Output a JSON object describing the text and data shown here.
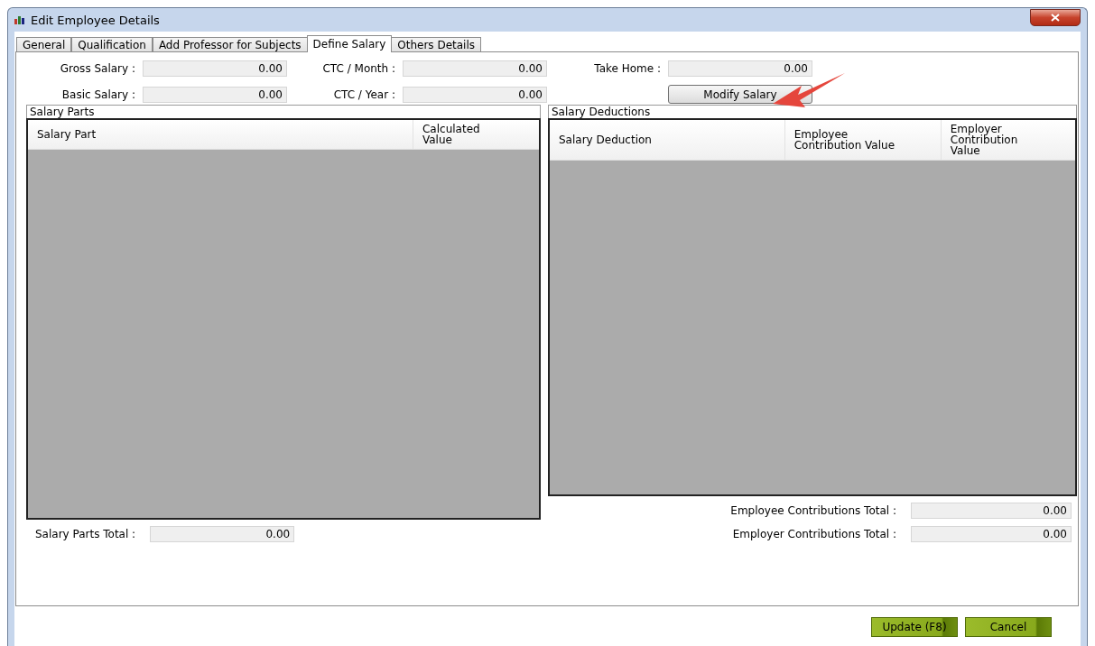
{
  "window": {
    "title": "Edit Employee Details"
  },
  "tabs": [
    {
      "label": "General",
      "selected": false
    },
    {
      "label": "Qualification",
      "selected": false
    },
    {
      "label": "Add Professor for Subjects",
      "selected": false
    },
    {
      "label": "Define Salary",
      "selected": true
    },
    {
      "label": "Others Details",
      "selected": false
    }
  ],
  "salary_fields": [
    {
      "label": "Gross Salary :",
      "value": "0.00"
    },
    {
      "label": "CTC / Month :",
      "value": "0.00"
    },
    {
      "label": "Take Home :",
      "value": "0.00"
    },
    {
      "label": "Basic Salary :",
      "value": "0.00"
    },
    {
      "label": "CTC / Year :",
      "value": "0.00"
    }
  ],
  "modify_button": "Modify Salary",
  "salary_parts": {
    "title": "Salary Parts",
    "columns": [
      "Salary Part",
      "Calculated Value"
    ],
    "totals": [
      {
        "label": "Salary Parts Total :",
        "value": "0.00"
      }
    ]
  },
  "salary_deductions": {
    "title": "Salary Deductions",
    "columns": [
      "Salary Deduction",
      "Employee Contribution Value",
      "Employer Contribution Value"
    ],
    "totals": [
      {
        "label": "Employee Contributions Total :",
        "value": "0.00"
      },
      {
        "label": "Employer Contributions Total :",
        "value": "0.00"
      }
    ]
  },
  "buttons": [
    "Update (F8)",
    "Cancel"
  ]
}
